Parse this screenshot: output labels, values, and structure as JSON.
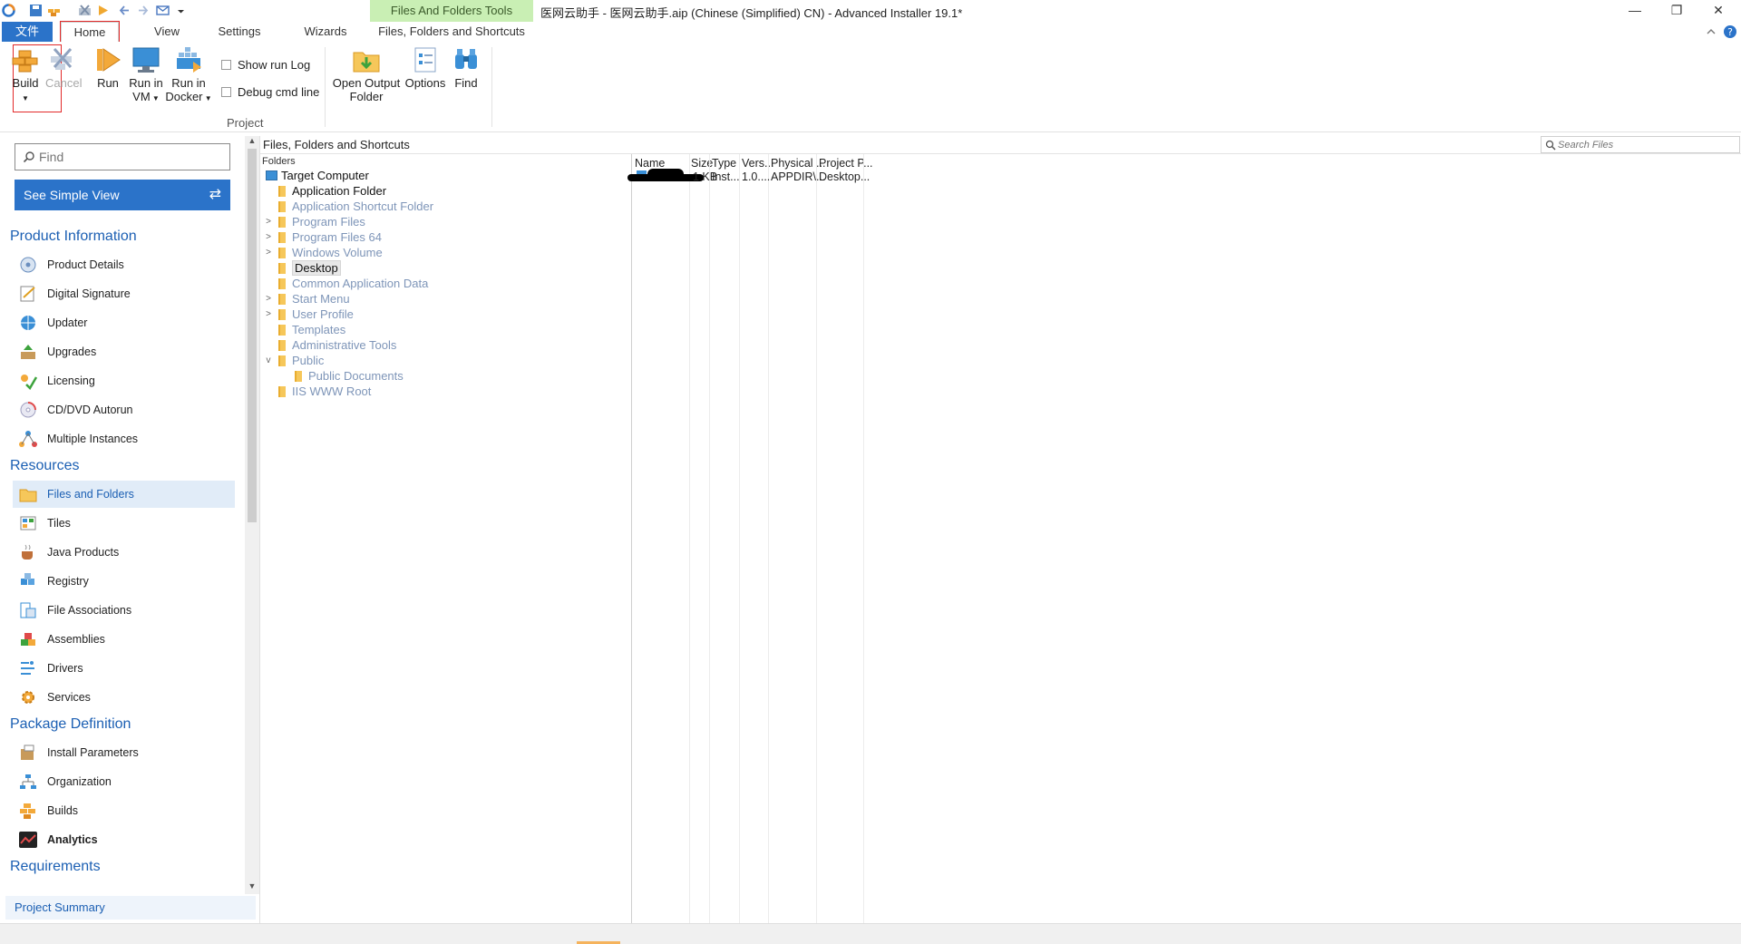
{
  "window": {
    "contextual_group": "Files And Folders Tools",
    "title": "医网云助手 - 医网云助手.aip (Chinese (Simplified) CN) - Advanced Installer 19.1*",
    "controls": {
      "minimize": "—",
      "restore": "❐",
      "close": "✕"
    }
  },
  "ribbon": {
    "tabs": {
      "file": "文件",
      "home": "Home",
      "view": "View",
      "settings": "Settings",
      "wizards": "Wizards",
      "ffs": "Files, Folders and Shortcuts"
    },
    "buttons": {
      "build": "Build",
      "cancel": "Cancel",
      "run": "Run",
      "run_vm_1": "Run in",
      "run_vm_2": "VM",
      "run_docker_1": "Run in",
      "run_docker_2": "Docker",
      "open_output_1": "Open Output",
      "open_output_2": "Folder",
      "options": "Options",
      "find": "Find"
    },
    "checkboxes": {
      "show_run_log": "Show run Log",
      "debug_cmd_line": "Debug cmd line"
    },
    "group_label": "Project"
  },
  "left": {
    "find_placeholder": "Find",
    "simple_view": "See Simple View",
    "sections": {
      "product_information": "Product Information",
      "resources": "Resources",
      "package_definition": "Package Definition",
      "requirements": "Requirements"
    },
    "items": {
      "product_details": "Product Details",
      "digital_signature": "Digital Signature",
      "updater": "Updater",
      "upgrades": "Upgrades",
      "licensing": "Licensing",
      "cd_dvd_autorun": "CD/DVD Autorun",
      "multiple_instances": "Multiple Instances",
      "files_and_folders": "Files and Folders",
      "tiles": "Tiles",
      "java_products": "Java Products",
      "registry": "Registry",
      "file_associations": "File Associations",
      "assemblies": "Assemblies",
      "drivers": "Drivers",
      "services": "Services",
      "install_parameters": "Install Parameters",
      "organization": "Organization",
      "builds": "Builds",
      "analytics": "Analytics"
    },
    "project_summary": "Project Summary"
  },
  "main": {
    "view_title": "Files, Folders and Shortcuts",
    "search_placeholder": "Search Files",
    "folders_label": "Folders",
    "tree": {
      "target_computer": "Target Computer",
      "application_folder": "Application Folder",
      "application_shortcut_folder": "Application Shortcut Folder",
      "program_files": "Program Files",
      "program_files_64": "Program Files 64",
      "windows_volume": "Windows Volume",
      "desktop": "Desktop",
      "common_application_data": "Common Application Data",
      "start_menu": "Start Menu",
      "user_profile": "User Profile",
      "templates": "Templates",
      "administrative_tools": "Administrative Tools",
      "public": "Public",
      "public_documents": "Public Documents",
      "iis_www_root": "IIS WWW Root"
    },
    "columns": {
      "name": "Name",
      "size": "Size",
      "type": "Type",
      "version": "Vers...",
      "physical": "Physical ...",
      "project": "Project P..."
    },
    "row": {
      "size": "1 KB",
      "type": "Inst...",
      "version": "1.0....",
      "physical": "APPDIR\\...",
      "project": "Desktop..."
    }
  }
}
